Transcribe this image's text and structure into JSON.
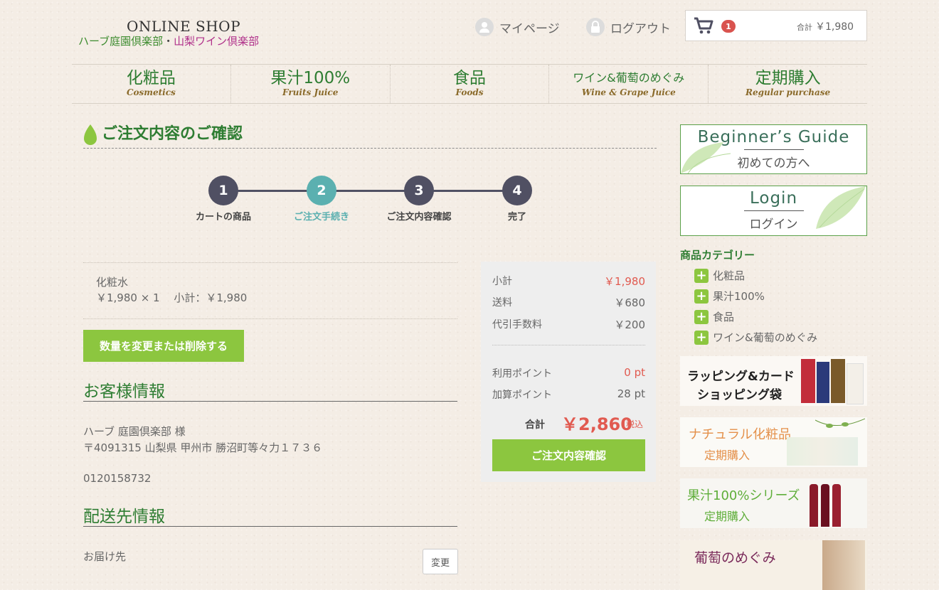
{
  "header": {
    "logo_top": "ONLINE SHOP",
    "logo_sub_a": "ハーブ庭園倶楽部",
    "logo_sub_dot": "・",
    "logo_sub_b": "山梨ワイン倶楽部",
    "mypage": "マイページ",
    "logout": "ログアウト",
    "cart_count": "1",
    "cart_total_label": "合計",
    "cart_total": "￥1,980"
  },
  "nav": [
    {
      "jp": "化粧品",
      "en": "Cosmetics"
    },
    {
      "jp": "果汁100%",
      "en": "Fruits Juice"
    },
    {
      "jp": "食品",
      "en": "Foods"
    },
    {
      "jp": "ワイン&葡萄のめぐみ",
      "en": "Wine & Grape Juice"
    },
    {
      "jp": "定期購入",
      "en": "Regular purchase"
    }
  ],
  "page_title": "ご注文内容のご確認",
  "steps": [
    {
      "num": "1",
      "label": "カートの商品"
    },
    {
      "num": "2",
      "label": "ご注文手続き"
    },
    {
      "num": "3",
      "label": "ご注文内容確認"
    },
    {
      "num": "4",
      "label": "完了"
    }
  ],
  "item": {
    "name": "化粧水",
    "price_line": "￥1,980 × 1　 小計：￥1,980"
  },
  "change_qty_button": "数量を変更または削除する",
  "customer": {
    "heading": "お客様情報",
    "name": "ハーブ 庭園倶楽部 様",
    "address": "〒4091315 山梨県 甲州市 勝沼町等々力１７３６",
    "phone": "0120158732"
  },
  "delivery": {
    "heading": "配送先情報",
    "label": "お届け先",
    "change_button": "変更"
  },
  "summary": {
    "subtotal_label": "小計",
    "subtotal": "￥1,980",
    "shipping_label": "送料",
    "shipping": "￥680",
    "cod_label": "代引手数料",
    "cod": "￥200",
    "use_points_label": "利用ポイント",
    "use_points": "0 pt",
    "add_points_label": "加算ポイント",
    "add_points": "28 pt",
    "total_label": "合計",
    "total": "￥2,860",
    "tax": "税込",
    "confirm_button": "ご注文内容確認"
  },
  "sidebar": {
    "beginner_en": "Beginner’s Guide",
    "beginner_jp": "初めての方へ",
    "login_en": "Login",
    "login_jp": "ログイン",
    "category_heading": "商品カテゴリー",
    "categories": [
      "化粧品",
      "果汁100%",
      "食品",
      "ワイン&葡萄のめぐみ"
    ],
    "banners": [
      {
        "line1": "ラッピング&カード",
        "line2": "ショッピング袋"
      },
      {
        "line1": "ナチュラル化粧品",
        "line2": "定期購入"
      },
      {
        "line1": "果汁100%シリーズ",
        "line2": "定期購入"
      },
      {
        "line1": "葡萄のめぐみ",
        "line2": ""
      }
    ]
  },
  "colors": {
    "brand_green": "#2e7d32",
    "accent_green": "#8cc63f",
    "step_teal": "#5bb0b0",
    "step_dark": "#505063",
    "price_red": "#e15a50"
  }
}
